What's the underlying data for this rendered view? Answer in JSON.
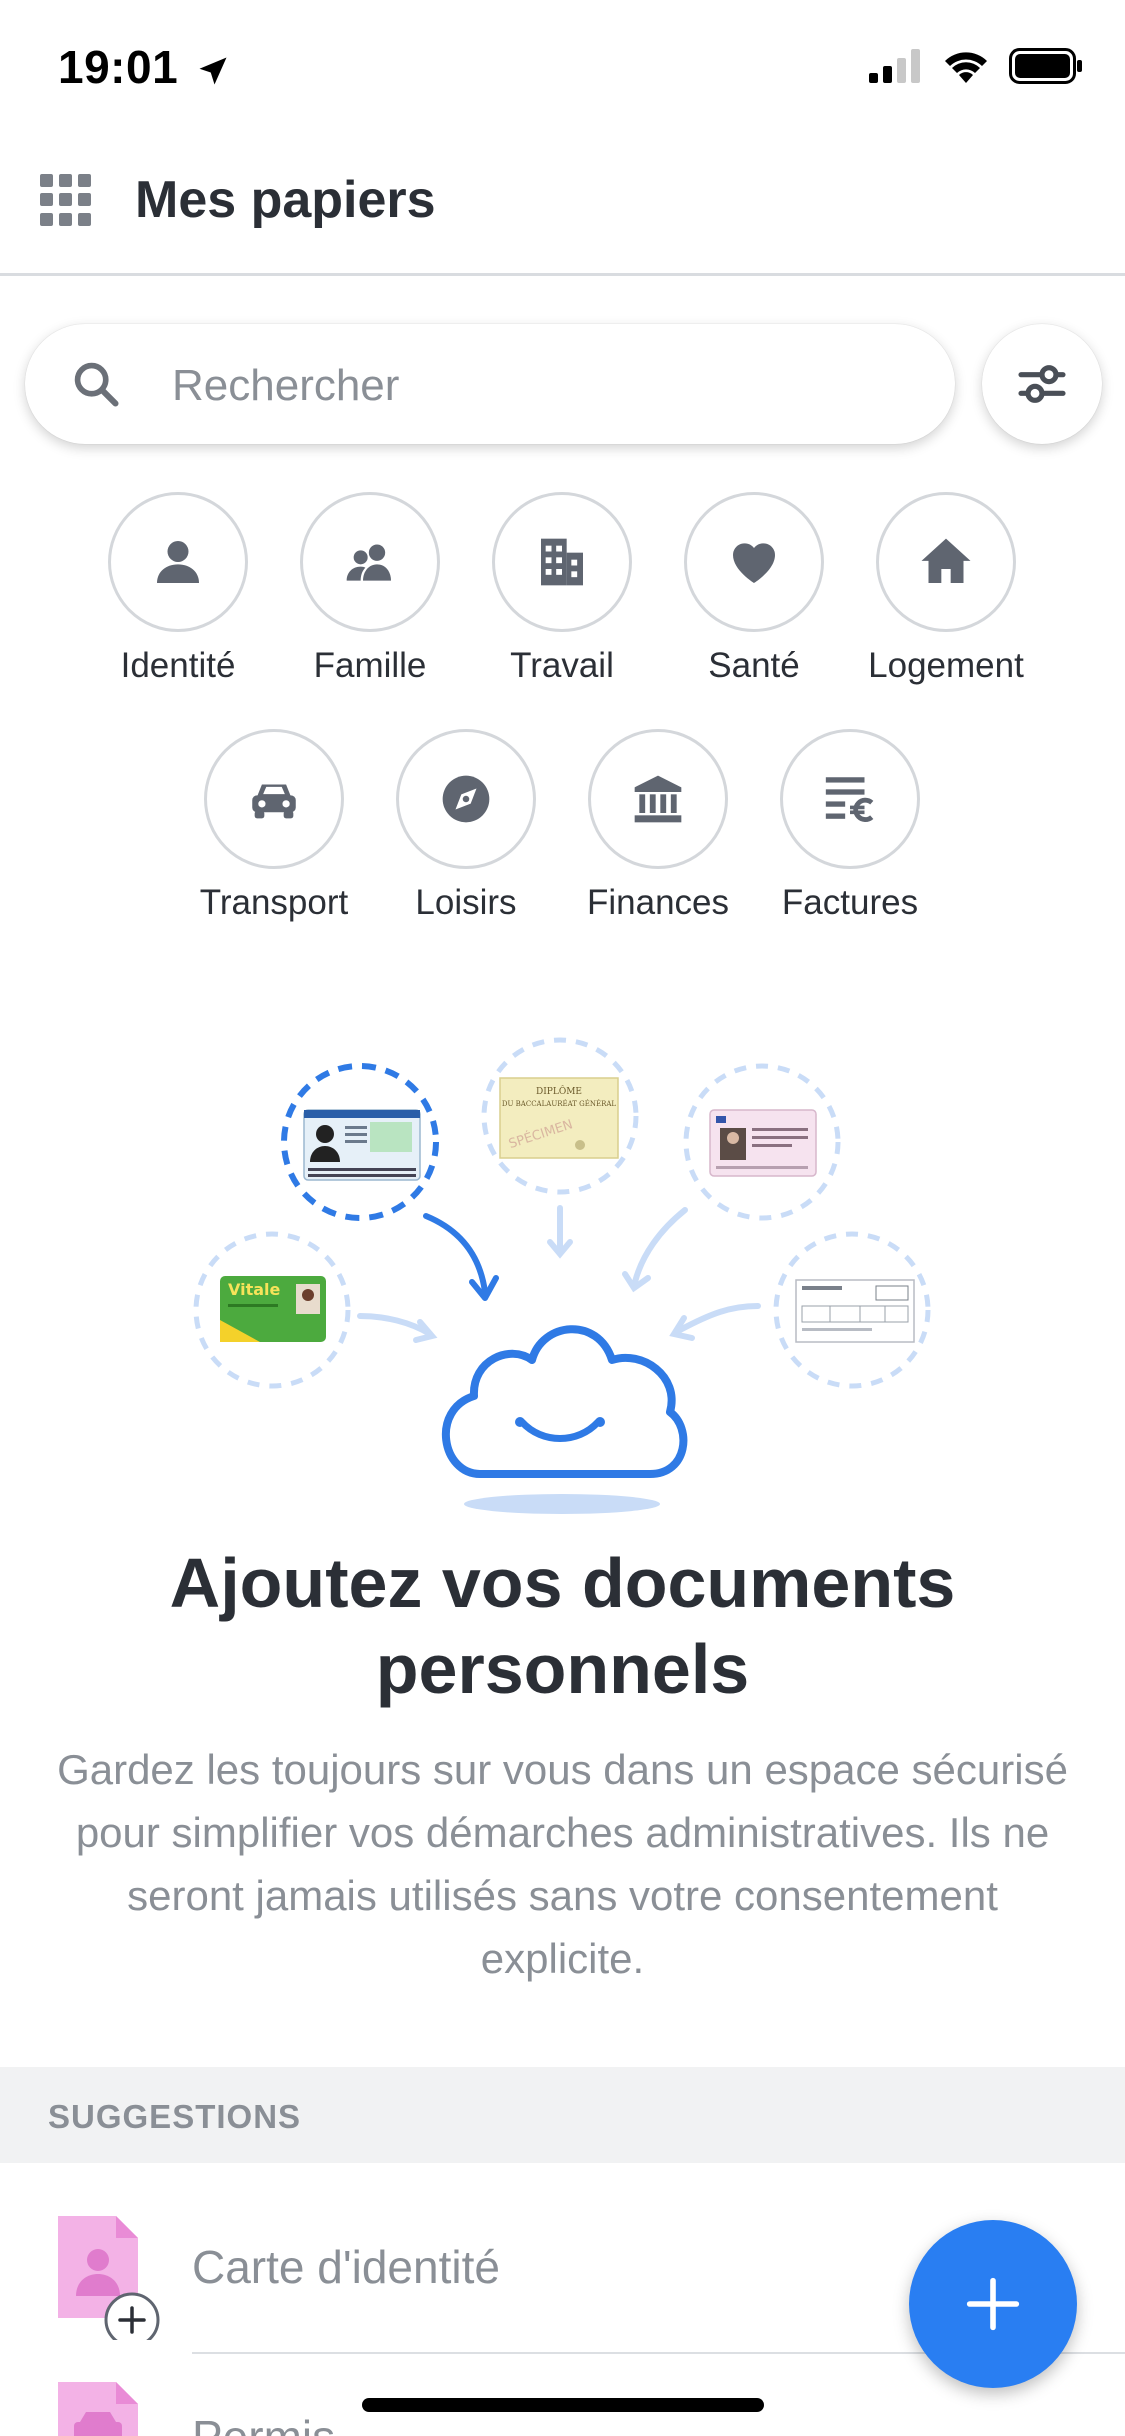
{
  "status_bar": {
    "time": "19:01"
  },
  "header": {
    "title": "Mes papiers"
  },
  "search": {
    "placeholder": "Rechercher"
  },
  "categories": [
    {
      "label": "Identité",
      "icon": "person-icon"
    },
    {
      "label": "Famille",
      "icon": "family-icon"
    },
    {
      "label": "Travail",
      "icon": "building-icon"
    },
    {
      "label": "Santé",
      "icon": "heart-icon"
    },
    {
      "label": "Logement",
      "icon": "house-icon"
    },
    {
      "label": "Transport",
      "icon": "car-icon"
    },
    {
      "label": "Loisirs",
      "icon": "compass-icon"
    },
    {
      "label": "Finances",
      "icon": "bank-icon"
    },
    {
      "label": "Factures",
      "icon": "bill-euro-icon"
    }
  ],
  "hero": {
    "title": "Ajoutez vos documents personnels",
    "text": "Gardez les toujours sur vous dans un espace sécurisé pour simplifier vos démarches administratives. Ils ne seront jamais utilisés sans votre consentement explicite.",
    "illustration_texts": {
      "vitale": "Vitale",
      "diploma_line1": "DIPLÔME",
      "diploma_line2": "DU BACCALAURÉAT GÉNÉRAL",
      "diploma_stamp": "SPÉCIMEN"
    }
  },
  "suggestions": {
    "title": "SUGGESTIONS",
    "items": [
      {
        "label": "Carte d'identité"
      },
      {
        "label": "Permis"
      }
    ]
  },
  "colors": {
    "accent": "#297ef2",
    "icon": "#5f6570",
    "suggestion_icon": "#f3b2e6"
  }
}
